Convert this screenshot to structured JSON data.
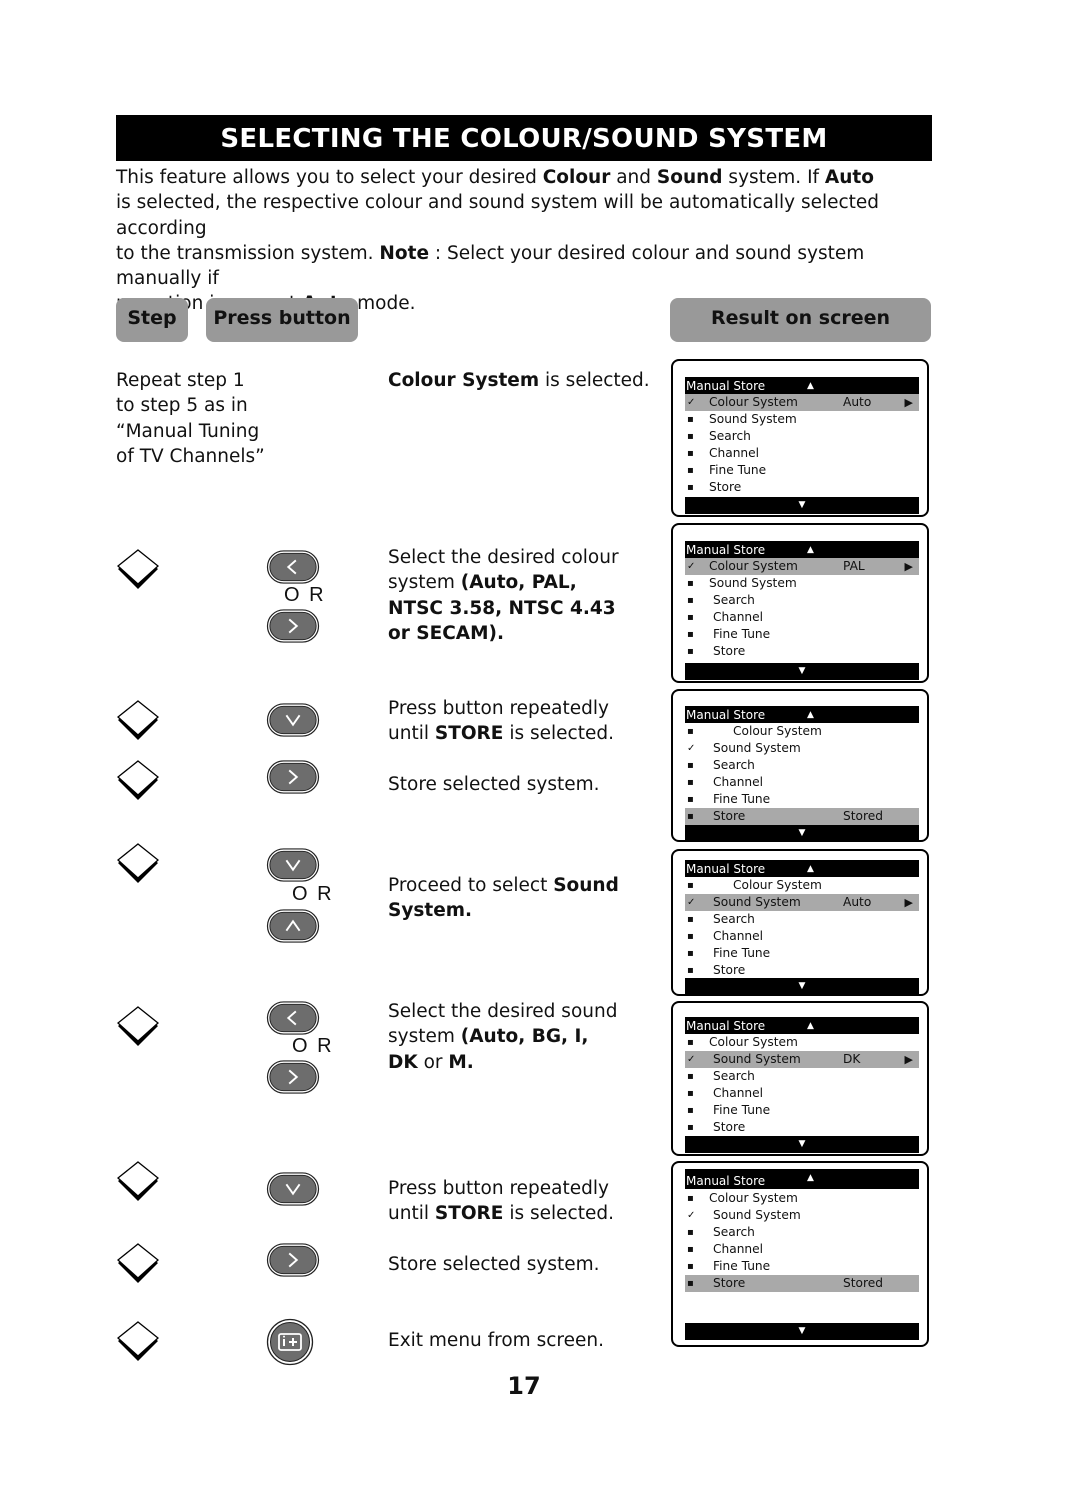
{
  "title": "SELECTING THE COLOUR/SOUND SYSTEM",
  "intro": {
    "l1_a": "This feature allows you to select your desired ",
    "l1_b": "Colour",
    "l1_c": " and ",
    "l1_d": "Sound",
    "l1_e": " system. If ",
    "l1_f": "Auto",
    "l2": "is selected, the respective colour and sound system will be automatically selected according",
    "l3_a": "to the transmission system. ",
    "l3_b": "Note",
    "l3_c": " : Select your desired colour and sound system manually if",
    "l4_a": "reception is poor at ",
    "l4_b": "Auto",
    "l4_c": " mode."
  },
  "headers": {
    "step": "Step",
    "press": "Press button",
    "result": "Result on screen"
  },
  "steps": {
    "s1": {
      "step_text": [
        "Repeat step 1",
        "to step 5 as in",
        "“Manual Tuning",
        "of TV Channels”"
      ],
      "desc_a": "Colour System",
      "desc_b": " is selected."
    },
    "s2": {
      "desc_1": "Select the desired colour",
      "desc_2a": "system  ",
      "desc_2b": "(Auto, PAL,",
      "desc_3": "NTSC 3.58, NTSC 4.43",
      "desc_4": "or SECAM).",
      "or": "O R"
    },
    "s3": {
      "desc_1": "Press button repeatedly",
      "desc_2a": "until ",
      "desc_2b": "STORE",
      "desc_2c": " is selected."
    },
    "s4": {
      "desc": "Store selected system."
    },
    "s5": {
      "desc_a": "Proceed to select ",
      "desc_b": "Sound",
      "desc_c": "System.",
      "or": "O R"
    },
    "s6": {
      "desc_1": "Select the desired sound",
      "desc_2a": "system  ",
      "desc_2b": "(Auto, BG, I,",
      "desc_3a": "DK",
      "desc_3b": " or ",
      "desc_3c": "M.",
      "or": "O R"
    },
    "s7": {
      "desc_1": "Press button repeatedly",
      "desc_2a": "until ",
      "desc_2b": "STORE",
      "desc_2c": " is selected."
    },
    "s8": {
      "desc": "Store selected system."
    },
    "s9": {
      "desc": "Exit menu from screen."
    }
  },
  "buttons": {
    "left": "<",
    "right": ">",
    "down": "V",
    "up": "^",
    "info": "i+"
  },
  "menu": {
    "title": "Manual Store",
    "up_arrow": "▲",
    "down_arrow": "▼",
    "right_arrow": "▶",
    "check": "✓",
    "bullet": "▪",
    "items": [
      "Colour System",
      "Sound System",
      "Search",
      "Channel",
      "Fine Tune",
      "Store"
    ],
    "values": {
      "auto": "Auto",
      "pal": "PAL",
      "dk": "DK",
      "stored": "Stored"
    }
  },
  "page_number": "17"
}
